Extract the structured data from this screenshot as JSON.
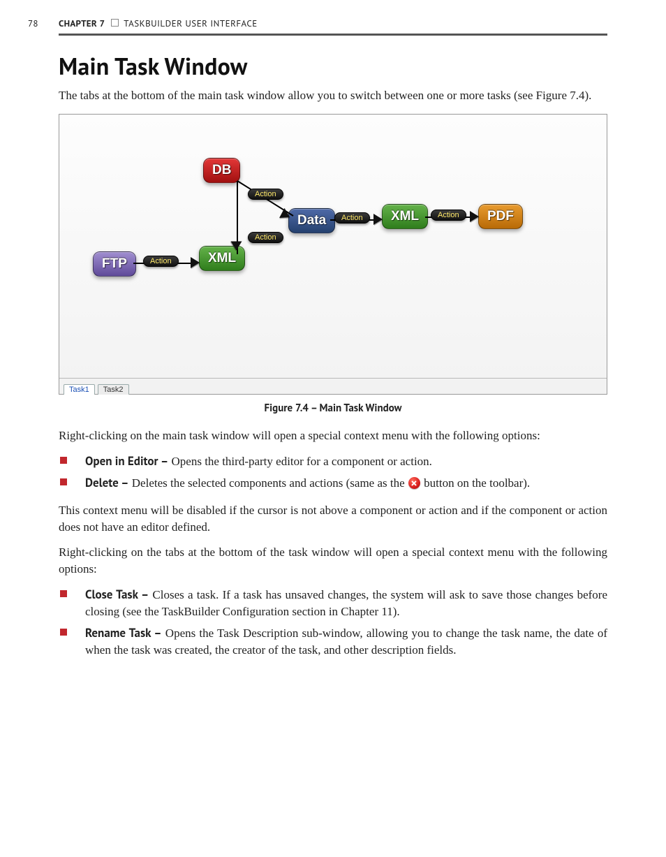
{
  "page_number": "78",
  "running_header": {
    "chapter_label": "CHAPTER 7",
    "chapter_title": "TASKBUILDER USER INTERFACE"
  },
  "heading": "Main Task Window",
  "intro_paragraph": "The tabs at the bottom of the main task window allow you to switch between one or more tasks (see Figure 7.4).",
  "figure": {
    "tabs": [
      "Task1",
      "Task2"
    ],
    "caption": "Figure 7.4 – Main Task Window",
    "nodes": {
      "db": "DB",
      "ftp": "FTP",
      "xml1": "XML",
      "data": "Data",
      "xml2": "XML",
      "pdf": "PDF"
    },
    "action_label": "Action"
  },
  "para_rightclick_main": "Right-clicking on the main task window will open a special context menu with the following options:",
  "list_main": [
    {
      "term": "Open in Editor –",
      "desc": " Opens the third-party editor for a component or action."
    },
    {
      "term": "Delete –",
      "desc_before": " Deletes the selected components and actions (same as the ",
      "desc_after": " button on the toolbar)."
    }
  ],
  "para_disabled": "This context menu will be disabled if the cursor is not above a component or action and if the component or action does not have an editor defined.",
  "para_rightclick_tabs": "Right-clicking on the tabs at the bottom of the task window will open a special context menu with the following options:",
  "list_tabs": [
    {
      "term": "Close Task –",
      "desc": " Closes a task. If a task has unsaved changes, the system will ask to save those changes before closing (see the TaskBuilder Configuration section in Chapter 11)."
    },
    {
      "term": "Rename Task –",
      "desc": " Opens the Task Description sub-window, allowing you to change the task name, the date of when the task was created, the creator of the task, and other description fields."
    }
  ]
}
